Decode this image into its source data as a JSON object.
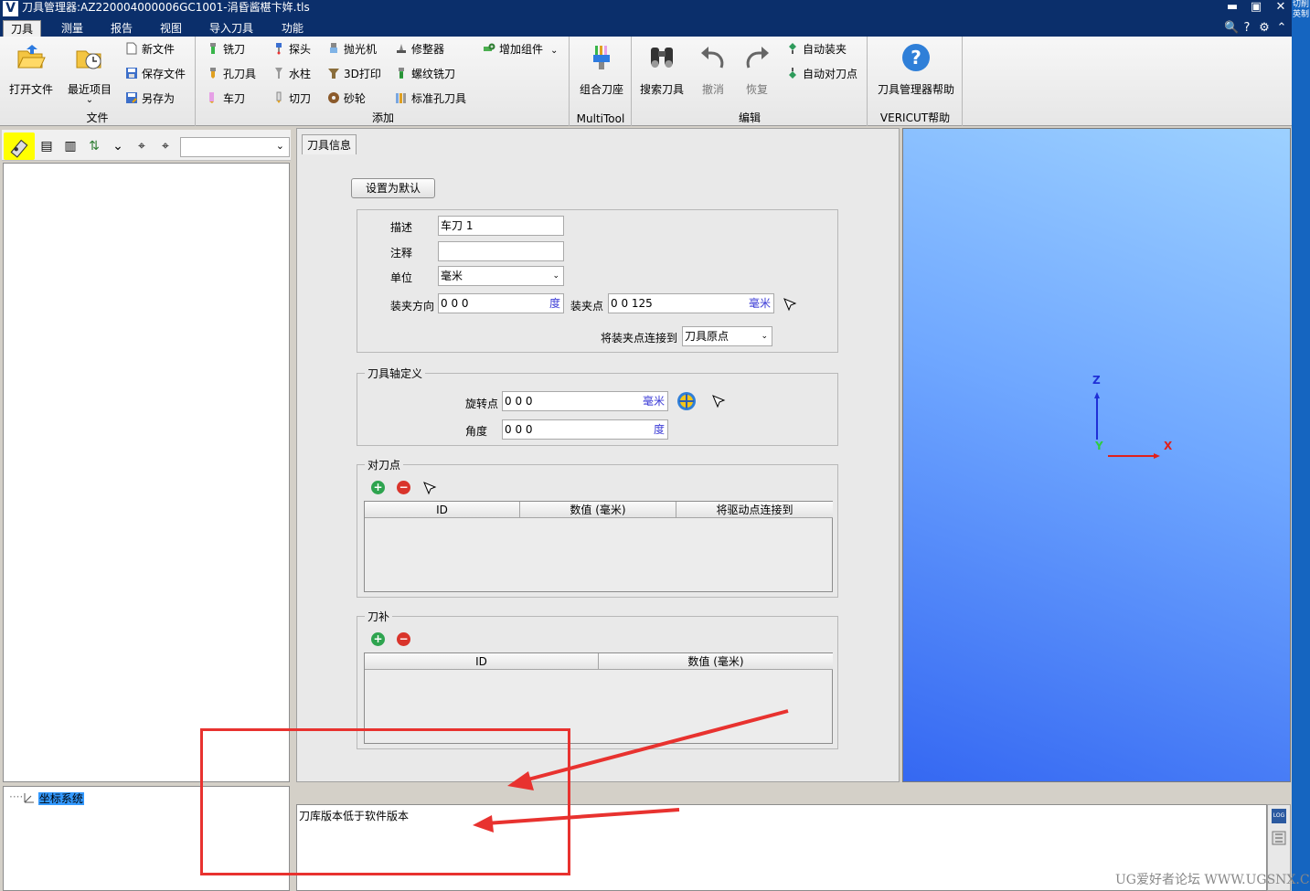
{
  "window": {
    "title": "刀具管理器:AZ220004000006GC1001-涓昏酱椹卞姩.tls",
    "logo": "V",
    "minimize": "▬",
    "maximize": "▣",
    "close": "✕"
  },
  "menu": {
    "tabs": [
      "刀具",
      "测量",
      "报告",
      "视图",
      "导入刀具",
      "功能"
    ],
    "right_icons": [
      "search-icon",
      "help-icon",
      "gear-icon",
      "chevron-up-icon"
    ],
    "right_glyphs": [
      "🔍",
      "?",
      "⚙",
      "⌃"
    ]
  },
  "ribbon": {
    "file": {
      "label": "文件",
      "open": "打开文件",
      "recent": "最近项目",
      "recent_arrow": "⌄",
      "new": "新文件",
      "save": "保存文件",
      "save_as": "另存为"
    },
    "add": {
      "label": "添加",
      "milling": "铣刀",
      "probe": "探头",
      "polish": "抛光机",
      "dresser": "修整器",
      "add_component": "增加组件",
      "add_component_arrow": "⌄",
      "hole": "孔刀具",
      "waterjet": "水柱",
      "print3d": "3D打印",
      "thread": "螺纹铣刀",
      "turning": "车刀",
      "cutoff": "切刀",
      "wheel": "砂轮",
      "std_hole": "标准孔刀具"
    },
    "multitool": {
      "label": "MultiTool",
      "combo": "组合刀座"
    },
    "edit": {
      "label": "编辑",
      "search": "搜索刀具",
      "undo": "撤消",
      "redo": "恢复",
      "auto_mount": "自动装夹",
      "auto_driven": "自动对刀点"
    },
    "help": {
      "label": "VERICUT帮助",
      "help": "刀具管理器帮助"
    }
  },
  "left": {
    "toolbar_glyphs": [
      "⌥",
      "▤",
      "▥",
      "⇅",
      "⌄",
      "⌖",
      "⌖"
    ],
    "select_value": "",
    "select_arrow": "⌄",
    "coord_node": "坐标系统",
    "coord_prefix": "····"
  },
  "tool_info": {
    "tab": "刀具信息",
    "set_default": "设置为默认",
    "description_label": "描述",
    "description": "车刀 1",
    "comment_label": "注释",
    "comment": "",
    "units_label": "单位",
    "units": "毫米",
    "clamp_dir_label": "装夹方向",
    "clamp_dir": "0 0 0",
    "clamp_dir_unit": "度",
    "clamp_pt_label": "装夹点",
    "clamp_pt": "0 0 125",
    "clamp_pt_unit": "毫米",
    "connect_label": "将装夹点连接到",
    "connect_value": "刀具原点",
    "axis_legend": "刀具轴定义",
    "pivot_label": "旋转点",
    "pivot": "0 0 0",
    "pivot_unit": "毫米",
    "angle_label": "角度",
    "angle": "0 0 0",
    "angle_unit": "度",
    "driven_legend": "对刀点",
    "driven_cols": [
      "ID",
      "数值 (毫米)",
      "将驱动点连接到"
    ],
    "comp_legend": "刀补",
    "comp_cols": [
      "ID",
      "数值 (毫米)"
    ],
    "plus": "+",
    "minus": "−",
    "select_arrow": "⌄"
  },
  "viewport": {
    "axis_z": "Z",
    "axis_x": "X",
    "axis_y": "Y",
    "colors": {
      "z": "#1f2fd6",
      "x": "#e0201c",
      "y": "#2ecc40"
    }
  },
  "message": {
    "text": "刀库版本低于软件版本",
    "log_icon": "LOG"
  },
  "watermark": "UG爱好者论坛 WWW.UGSNX.COM",
  "right_strip_text": "切削 英制"
}
